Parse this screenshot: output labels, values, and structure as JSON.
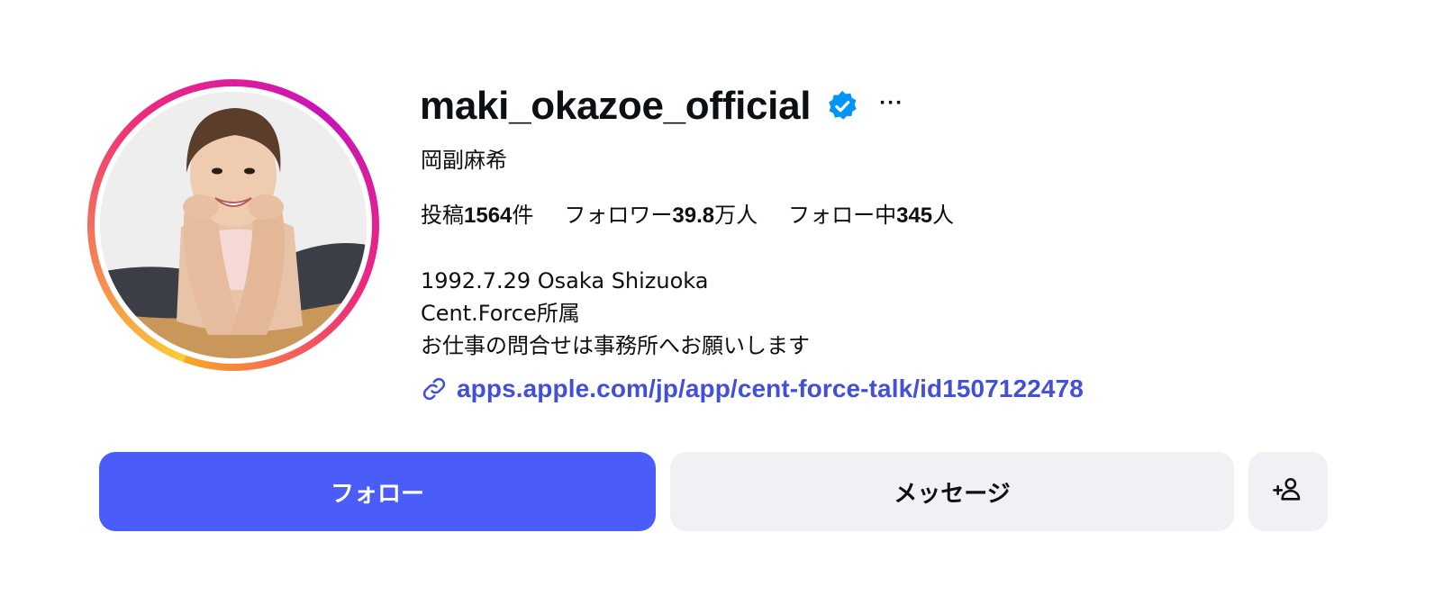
{
  "profile": {
    "username": "maki_okazoe_official",
    "verified": true,
    "more_label": "···",
    "full_name": "岡副麻希",
    "avatar_alt": "profile picture"
  },
  "stats": {
    "posts": {
      "prefix": "投稿",
      "value": "1564",
      "suffix": "件"
    },
    "followers": {
      "prefix": "フォロワー",
      "value": "39.8",
      "suffix": "万人"
    },
    "following": {
      "prefix": "フォロー中",
      "value": "345",
      "suffix": "人"
    }
  },
  "bio": {
    "lines": [
      "1992.7.29 Osaka Shizuoka",
      "Cent.Force所属",
      "お仕事の問合せは事務所へお願いします"
    ]
  },
  "link": {
    "text": "apps.apple.com/jp/app/cent-force-talk/id1507122478",
    "icon": "link-icon"
  },
  "actions": {
    "follow_label": "フォロー",
    "message_label": "メッセージ",
    "add_user_icon": "add-user-icon"
  },
  "colors": {
    "primary_button": "#4a5df9",
    "secondary_button": "#eff1f5",
    "link": "#4150d6",
    "verified_badge": "#0095f6"
  }
}
